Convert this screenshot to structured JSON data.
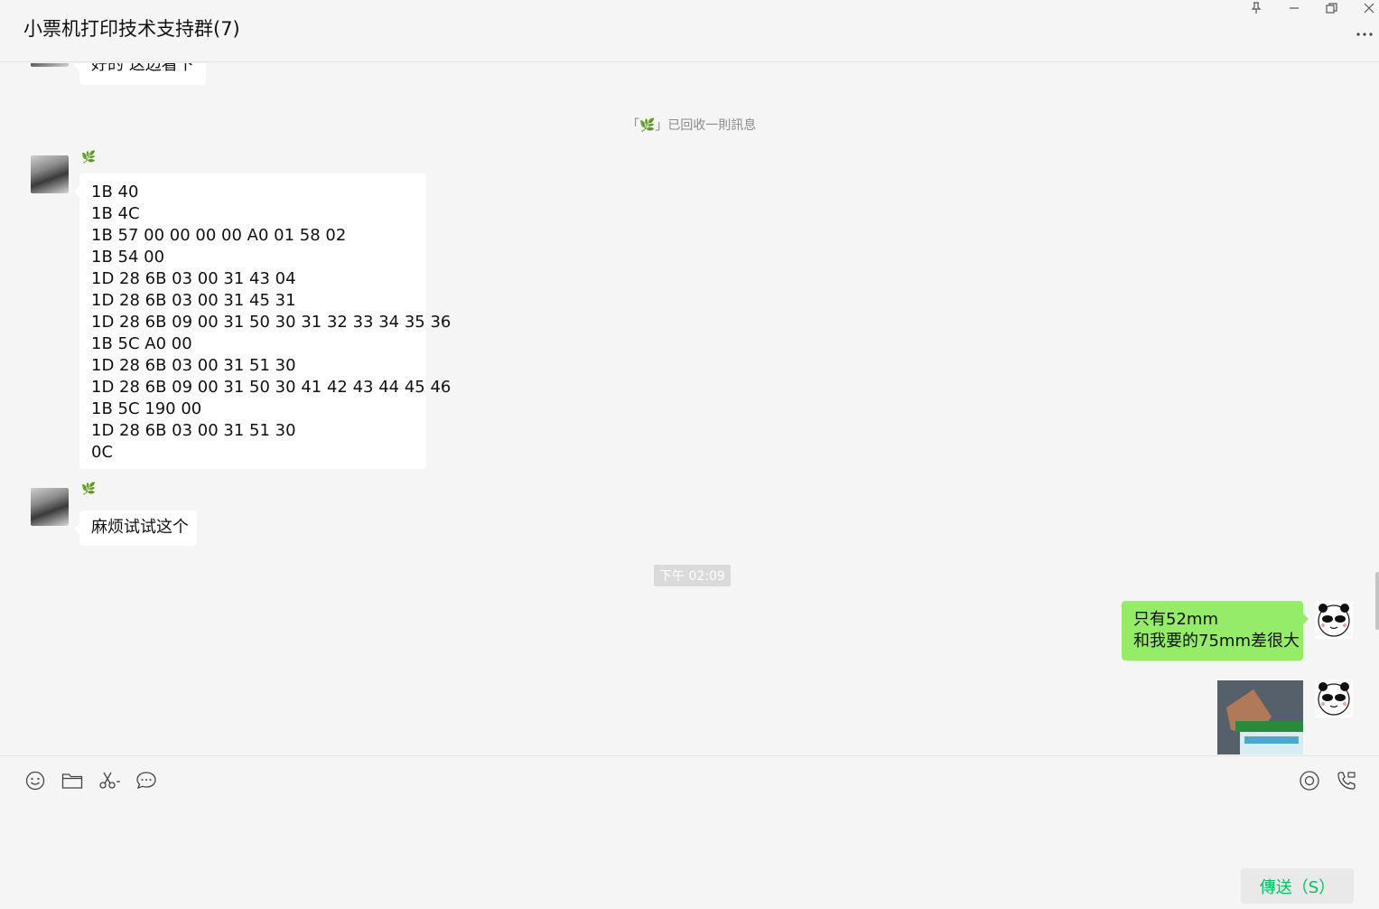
{
  "window": {
    "title": "小票机打印技术支持群(7)"
  },
  "chat": {
    "messages": {
      "partial_top": "好的 这边看下",
      "recall_notice": "「🌿」已回收一則訊息",
      "codes": "1B 40\n1B 4C\n1B 57 00 00 00 00 A0 01 58 02\n1B 54 00\n1D 28 6B 03 00 31 43 04\n1D 28 6B 03 00 31 45 31\n1D 28 6B 09 00 31 50 30 31 32 33 34 35 36\n1B 5C A0 00\n1D 28 6B 03 00 31 51 30\n1D 28 6B 09 00 31 50 30 41 42 43 44 45 46\n1B 5C 190 00\n1D 28 6B 03 00 31 51 30\n0C",
      "try_this": "麻烦试试这个",
      "time": "下午 02:09",
      "reply": "只有52mm\n和我要的75mm差很大"
    },
    "sender_icon": "🌿"
  },
  "input": {
    "send_label": "傳送（S）"
  },
  "colors": {
    "accent": "#07c160",
    "my_bubble": "#95ec69",
    "background": "#f5f5f5"
  }
}
